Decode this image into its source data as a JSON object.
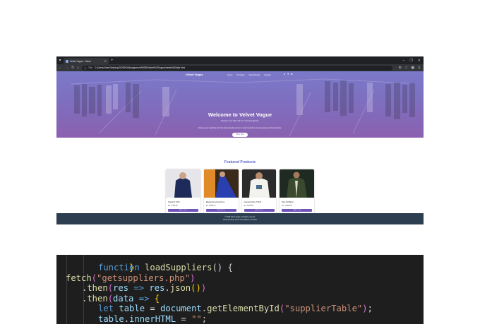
{
  "browser": {
    "tab_title": "Velvet Vogue - Home",
    "new_tab_symbol": "+",
    "address_chip": "File",
    "url": "C:/Users/User/Desktop/2025%20Assignment/WEB/Velvet%20Vogue/velvet%20site.html",
    "window_controls": [
      "–",
      "❐",
      "✕"
    ]
  },
  "site": {
    "brand": "Velvet Vogue",
    "nav": [
      "Home",
      "Products",
      "New Arrivals",
      "Contact"
    ],
    "hero": {
      "title": "Welcome to Velvet Vogue",
      "subtitle": "Discover Your Style with Our Trendy Collection",
      "description": "Elevate your wardrobe with the latest trends and our curated selection of casual wear and formal attire.",
      "button": "Shop Now"
    },
    "featured_title": "Featured Products",
    "products": [
      {
        "name": "Classic T-Shirt",
        "price": "Rs. 2,499.00",
        "button": "Add to Cart"
      },
      {
        "name": "Elegant Evening Dress",
        "price": "Rs. 8,999.00",
        "button": "Add to Cart"
      },
      {
        "name": "Casual Cotton T-Shirt",
        "price": "Rs. 2,999.00",
        "button": "Add to Cart"
      },
      {
        "name": "Men Fit Blazer",
        "price": "Rs. 12,999.00",
        "button": "Add to Cart"
      }
    ],
    "footer": {
      "line1": "© 2025 Velvet Vogue. All rights reserved.",
      "line2": "Privacy Policy | Terms & Conditions | Contact"
    }
  },
  "code": {
    "line1": "}",
    "line2_kw": "function",
    "line2_fn": "loadSuppliers",
    "line2_rest": "() {",
    "line3_fn": "fetch",
    "line3_str": "\"getsuppliers.php\"",
    "line4_fn": "then",
    "line4_var": "res",
    "line4_rest_a": " => ",
    "line4_var2": "res",
    "line4_fn2": "json",
    "line5_fn": "then",
    "line5_var": "data",
    "line6_kw": "let",
    "line6_var": "table",
    "line6_var2": "document",
    "line6_fn": "getElementById",
    "line6_str": "\"supplierTable\"",
    "line7_var": "table",
    "line7_prop": "innerHTML",
    "line7_str": "\"\""
  }
}
